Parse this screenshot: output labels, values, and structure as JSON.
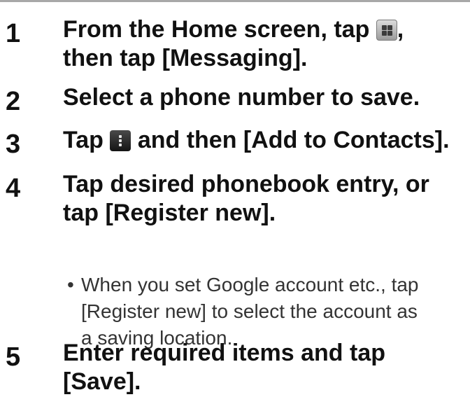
{
  "steps": [
    {
      "number": "1",
      "line1_before_icon": "From the Home screen, tap ",
      "line1_after_icon": ",",
      "line2": "then tap [Messaging].",
      "icon": "apps-grid-icon"
    },
    {
      "number": "2",
      "line1": "Select a phone number to save."
    },
    {
      "number": "3",
      "line1_before_icon": "Tap ",
      "line1_after_icon": " and then [Add to Contacts].",
      "icon": "menu-dots-icon"
    },
    {
      "number": "4",
      "line1": "Tap desired phonebook entry, or",
      "line2": "tap [Register new].",
      "note": {
        "bullet": "•",
        "line1": "When you set Google account etc., tap",
        "line2": "[Register new] to select the account as",
        "line3": "a saving location."
      }
    },
    {
      "number": "5",
      "line1": "Enter required items and tap",
      "line2": "[Save]."
    }
  ],
  "colors": {
    "text": "#111111",
    "note_text": "#333333",
    "top_rule": "#a8a8a8"
  }
}
